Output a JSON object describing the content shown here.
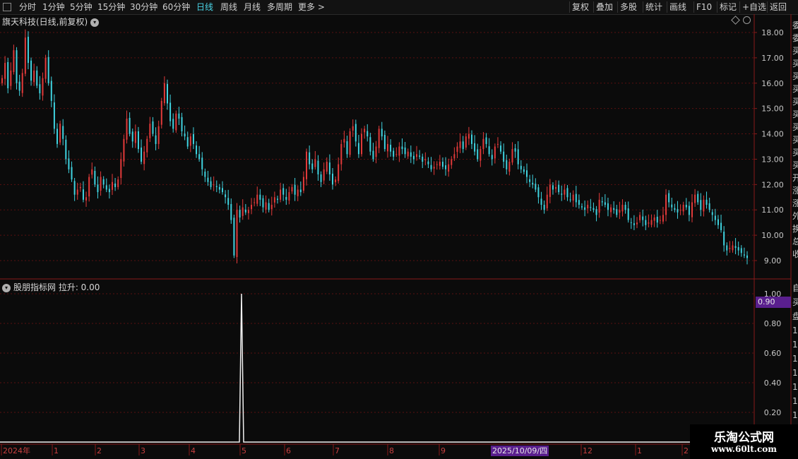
{
  "toolbar": {
    "left": [
      "分时",
      "1分钟",
      "5分钟",
      "15分钟",
      "30分钟",
      "60分钟",
      "日线",
      "周线",
      "月线",
      "多周期",
      "更多 >"
    ],
    "active": "日线",
    "right": [
      "复权",
      "叠加",
      "多股",
      "统计",
      "画线",
      "F10",
      "标记",
      "+自选",
      "返回"
    ]
  },
  "chart_title": "旗天科技(日线,前复权)",
  "indicator_title": "股朋指标网 拉升: 0.00",
  "price_axis": [
    "18.00",
    "17.00",
    "16.00",
    "15.00",
    "14.00",
    "13.00",
    "12.00",
    "11.00",
    "10.00",
    "9.00"
  ],
  "indicator_axis": [
    "1.00",
    "0.80",
    "0.60",
    "0.40",
    "0.20"
  ],
  "indicator_price_tag": "0.90",
  "x_labels": [
    "2024年",
    "1",
    "2",
    "3",
    "4",
    "5",
    "6",
    "7",
    "8",
    "9",
    "12",
    "1",
    "2"
  ],
  "cursor_date": "2025/10/09/四",
  "right_side_text": [
    "委",
    "委",
    "买",
    "买",
    "买",
    "买",
    "买",
    "买",
    "买",
    "买",
    "买",
    "买",
    "开",
    "涨",
    "涨",
    "外",
    "换",
    "总",
    "收"
  ],
  "right_side_text_lower": [
    "自",
    "买",
    "盘",
    "1",
    "1",
    "1",
    "1",
    "1",
    "1",
    "1",
    "1"
  ],
  "watermark": {
    "title": "乐淘公式网",
    "url": "www.60lt.com"
  },
  "colors": {
    "up": "#e23a3a",
    "down": "#3fd3e0",
    "grid": "#5a1010",
    "tag": "#5a1f8e"
  },
  "chart_data": {
    "type": "candlestick",
    "title": "旗天科技(日线,前复权)",
    "ylim": [
      8.6,
      18.3
    ],
    "closes": [
      16.2,
      16.8,
      15.8,
      16.5,
      17.3,
      16.0,
      15.7,
      16.4,
      17.8,
      16.8,
      16.1,
      16.5,
      15.9,
      15.6,
      16.2,
      17.0,
      16.0,
      15.3,
      14.2,
      13.6,
      14.4,
      13.8,
      13.0,
      12.6,
      12.2,
      11.6,
      11.8,
      11.9,
      11.4,
      11.5,
      12.3,
      12.6,
      12.0,
      11.7,
      12.3,
      12.0,
      11.8,
      11.7,
      12.1,
      11.9,
      12.2,
      13.0,
      13.8,
      14.6,
      14.0,
      13.7,
      14.1,
      13.4,
      12.9,
      13.3,
      13.8,
      14.4,
      14.0,
      13.6,
      14.3,
      15.3,
      16.0,
      15.2,
      14.5,
      14.2,
      14.8,
      14.6,
      14.1,
      13.9,
      13.5,
      13.9,
      13.6,
      13.2,
      13.0,
      12.6,
      12.3,
      12.1,
      11.9,
      12.0,
      11.9,
      11.8,
      11.7,
      11.5,
      11.2,
      10.6,
      9.2,
      11.0,
      10.7,
      11.1,
      10.9,
      11.0,
      11.2,
      11.3,
      11.6,
      11.4,
      11.1,
      11.3,
      11.0,
      11.2,
      11.5,
      11.4,
      11.8,
      11.6,
      11.4,
      11.7,
      11.9,
      11.6,
      11.8,
      11.7,
      12.3,
      13.3,
      12.8,
      12.6,
      13.0,
      12.4,
      12.1,
      12.6,
      12.9,
      12.4,
      12.0,
      12.2,
      12.8,
      13.6,
      13.8,
      13.2,
      14.1,
      14.3,
      13.7,
      13.2,
      14.0,
      14.2,
      13.9,
      13.3,
      13.0,
      13.5,
      14.2,
      13.9,
      13.4,
      13.6,
      13.3,
      13.1,
      13.2,
      13.5,
      13.4,
      13.2,
      13.3,
      13.1,
      13.0,
      13.2,
      13.1,
      12.9,
      13.0,
      12.8,
      12.6,
      12.7,
      12.8,
      12.9,
      12.7,
      12.6,
      12.8,
      13.0,
      13.2,
      13.5,
      13.7,
      13.4,
      13.9,
      14.0,
      13.6,
      13.3,
      13.0,
      13.4,
      13.8,
      13.6,
      13.2,
      13.0,
      13.5,
      13.6,
      13.3,
      12.9,
      12.6,
      12.9,
      13.4,
      13.3,
      12.8,
      12.6,
      12.5,
      12.3,
      12.1,
      12.0,
      11.8,
      11.5,
      11.2,
      11.0,
      11.6,
      12.0,
      11.8,
      11.9,
      11.7,
      11.6,
      11.8,
      11.5,
      11.4,
      11.6,
      11.3,
      11.2,
      11.1,
      11.0,
      11.2,
      11.1,
      11.0,
      10.8,
      11.4,
      11.3,
      11.2,
      11.0,
      11.1,
      11.0,
      10.8,
      11.0,
      11.2,
      11.0,
      10.6,
      10.5,
      10.4,
      10.5,
      10.8,
      10.6,
      10.4,
      10.5,
      10.6,
      10.7,
      10.5,
      10.6,
      10.8,
      11.6,
      11.3,
      11.1,
      11.0,
      10.9,
      11.0,
      11.2,
      11.1,
      10.8,
      11.3,
      11.6,
      11.3,
      11.0,
      11.4,
      11.2,
      11.0,
      10.8,
      10.6,
      10.4,
      10.2,
      9.6,
      9.4,
      9.5,
      9.6,
      9.5,
      9.4,
      9.3,
      9.2,
      9.1
    ],
    "signal_spike": {
      "value": 1.0,
      "baseline": 0.0
    },
    "indicator_ylim": [
      0,
      1.05
    ]
  }
}
